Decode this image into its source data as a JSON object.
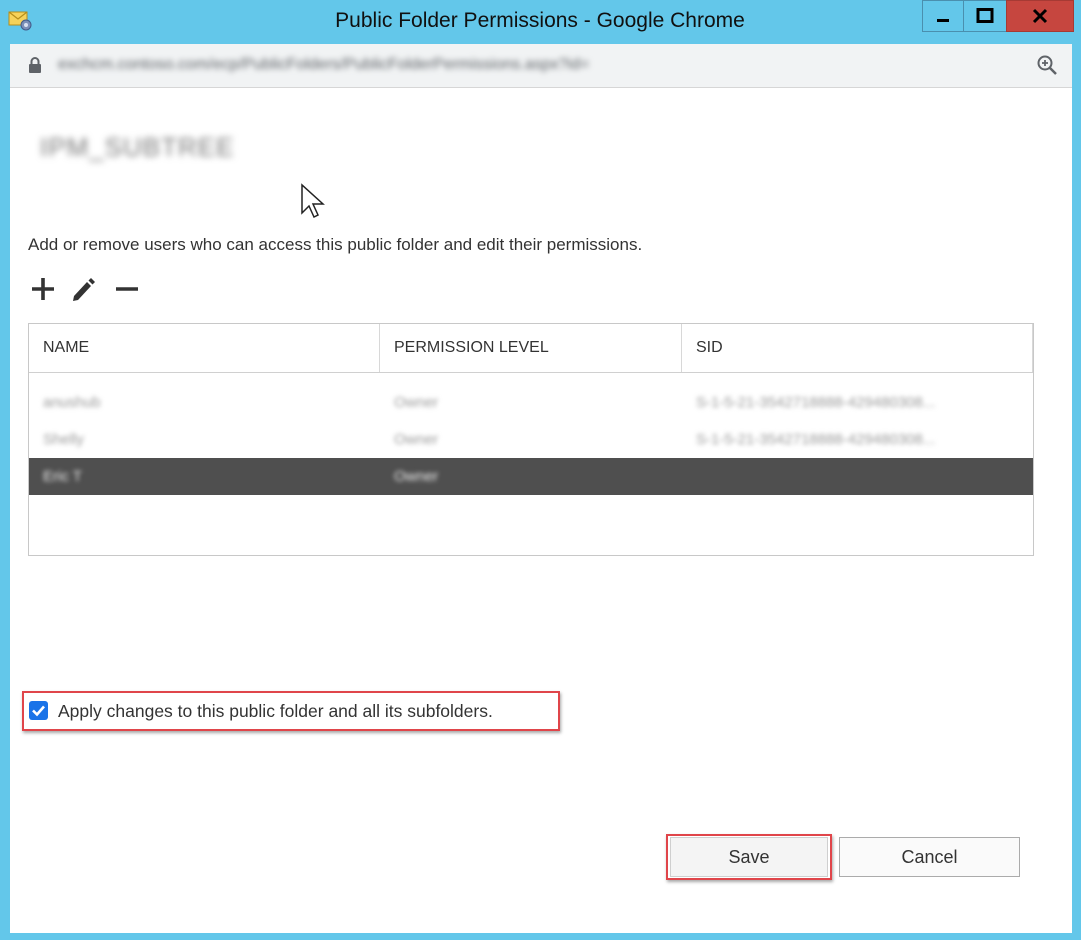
{
  "window": {
    "title": "Public Folder Permissions - Google Chrome",
    "controls": {
      "minimize": "minimize-icon",
      "maximize": "maximize-icon",
      "close": "close-icon"
    }
  },
  "addressbar": {
    "url": "exchcm.contoso.com/ecp/PublicFolders/PublicFolderPermissions.aspx?id=",
    "icons": [
      "lock-icon",
      "zoom-icon"
    ]
  },
  "page": {
    "folder_name": "IPM_SUBTREE",
    "instructions": "Add or remove users who can access this public folder and edit their permissions.",
    "toolbar_icons": [
      "add-icon",
      "edit-icon",
      "remove-icon"
    ],
    "table": {
      "columns": [
        "NAME",
        "PERMISSION LEVEL",
        "SID"
      ],
      "rows": [
        {
          "name": "anushub",
          "permission": "Owner",
          "sid": "S-1-5-21-3542718888-429480308..."
        },
        {
          "name": "Shelly",
          "permission": "Owner",
          "sid": "S-1-5-21-3542718888-429480308..."
        },
        {
          "name": "Eric T",
          "permission": "Owner",
          "sid": ""
        }
      ],
      "selected_row": 2
    },
    "checkbox": {
      "checked": true,
      "label": "Apply changes to this public folder and all its subfolders."
    },
    "buttons": {
      "save": "Save",
      "cancel": "Cancel"
    }
  },
  "colors": {
    "frame": "#63c7ea",
    "close_button": "#c6463f",
    "highlight": "#e0454a",
    "selected_row": "#4f4f4f",
    "checkbox": "#1a73e8"
  }
}
